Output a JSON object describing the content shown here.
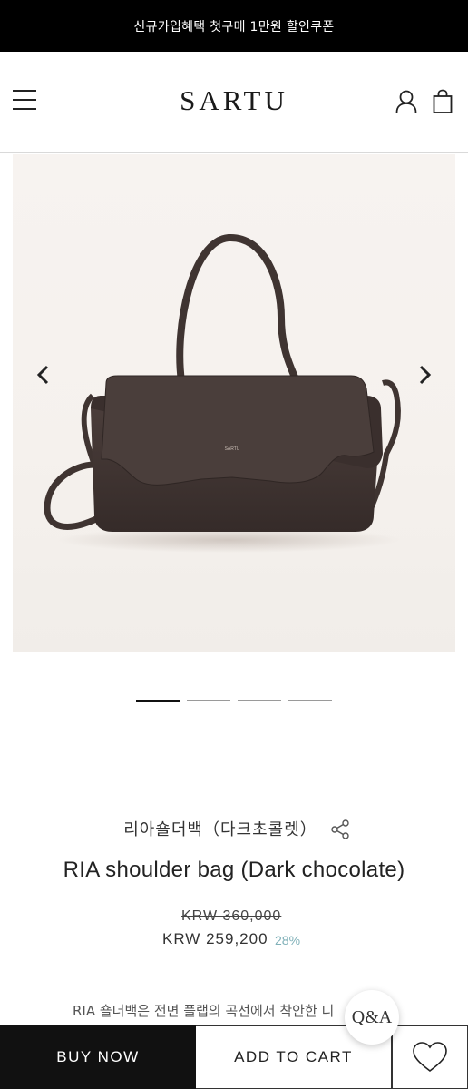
{
  "promo": {
    "text": "신규가입혜택 첫구매 1만원 할인쿠폰"
  },
  "header": {
    "logo": "SARTU",
    "menu_icon": "hamburger-menu-icon",
    "user_icon": "user-icon",
    "cart_icon": "shopping-bag-icon"
  },
  "gallery": {
    "prev_icon": "chevron-left-icon",
    "next_icon": "chevron-right-icon",
    "slide_count": 4,
    "active_slide": 1,
    "bag_logo": "SARTU"
  },
  "product": {
    "name_ko": "리아숄더백（다크초콜렛）",
    "name_en": "RIA shoulder bag (Dark chocolate)",
    "price_original": "KRW 360,000",
    "price_sale": "KRW 259,200",
    "discount": "28%",
    "description": "RIA 숄더백은 전면 플랩의 곡선에서 착안한 디"
  },
  "actions": {
    "buy_now": "BUY NOW",
    "add_to_cart": "ADD TO CART",
    "wishlist_icon": "heart-icon",
    "qa_label": "Q&A"
  },
  "colors": {
    "promo_bg": "#000000",
    "buy_now_bg": "#111111",
    "discount": "#7fb0b8",
    "bag": "#3e3331",
    "gallery_bg": "#f5f1ed"
  }
}
